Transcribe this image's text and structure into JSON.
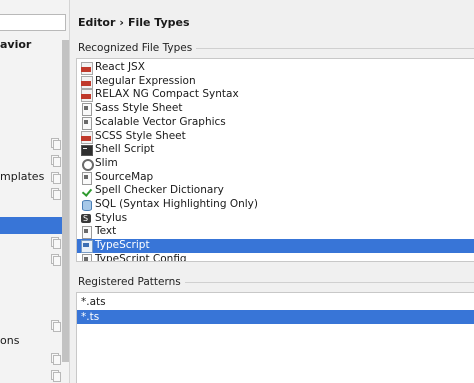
{
  "sidebar": {
    "labels": [
      "avior",
      "mplates",
      "ons"
    ]
  },
  "breadcrumb": {
    "parent": "Editor",
    "separator": "›",
    "current": "File Types"
  },
  "recognized": {
    "label": "Recognized File Types",
    "items": [
      {
        "name": "React JSX",
        "icon": "tag-icon"
      },
      {
        "name": "Regular Expression",
        "icon": "tag-icon"
      },
      {
        "name": "RELAX NG Compact Syntax",
        "icon": "tag-icon"
      },
      {
        "name": "Sass Style Sheet",
        "icon": "page-icon"
      },
      {
        "name": "Scalable Vector Graphics",
        "icon": "page-icon"
      },
      {
        "name": "SCSS Style Sheet",
        "icon": "tag-icon"
      },
      {
        "name": "Shell Script",
        "icon": "shell-icon"
      },
      {
        "name": "Slim",
        "icon": "gear-icon"
      },
      {
        "name": "SourceMap",
        "icon": "page-icon"
      },
      {
        "name": "Spell Checker Dictionary",
        "icon": "check-icon"
      },
      {
        "name": "SQL (Syntax Highlighting Only)",
        "icon": "database-icon"
      },
      {
        "name": "Stylus",
        "icon": "stylus-icon"
      },
      {
        "name": "Text",
        "icon": "page-icon"
      },
      {
        "name": "TypeScript",
        "icon": "typescript-icon"
      },
      {
        "name": "TypeScript Config",
        "icon": "page-icon"
      }
    ],
    "selected_index": 13
  },
  "patterns": {
    "label": "Registered Patterns",
    "items": [
      "*.ats",
      "*.ts"
    ],
    "selected_index": 1
  },
  "colors": {
    "selection": "#3875d7",
    "tag_red": "#c0392b"
  }
}
